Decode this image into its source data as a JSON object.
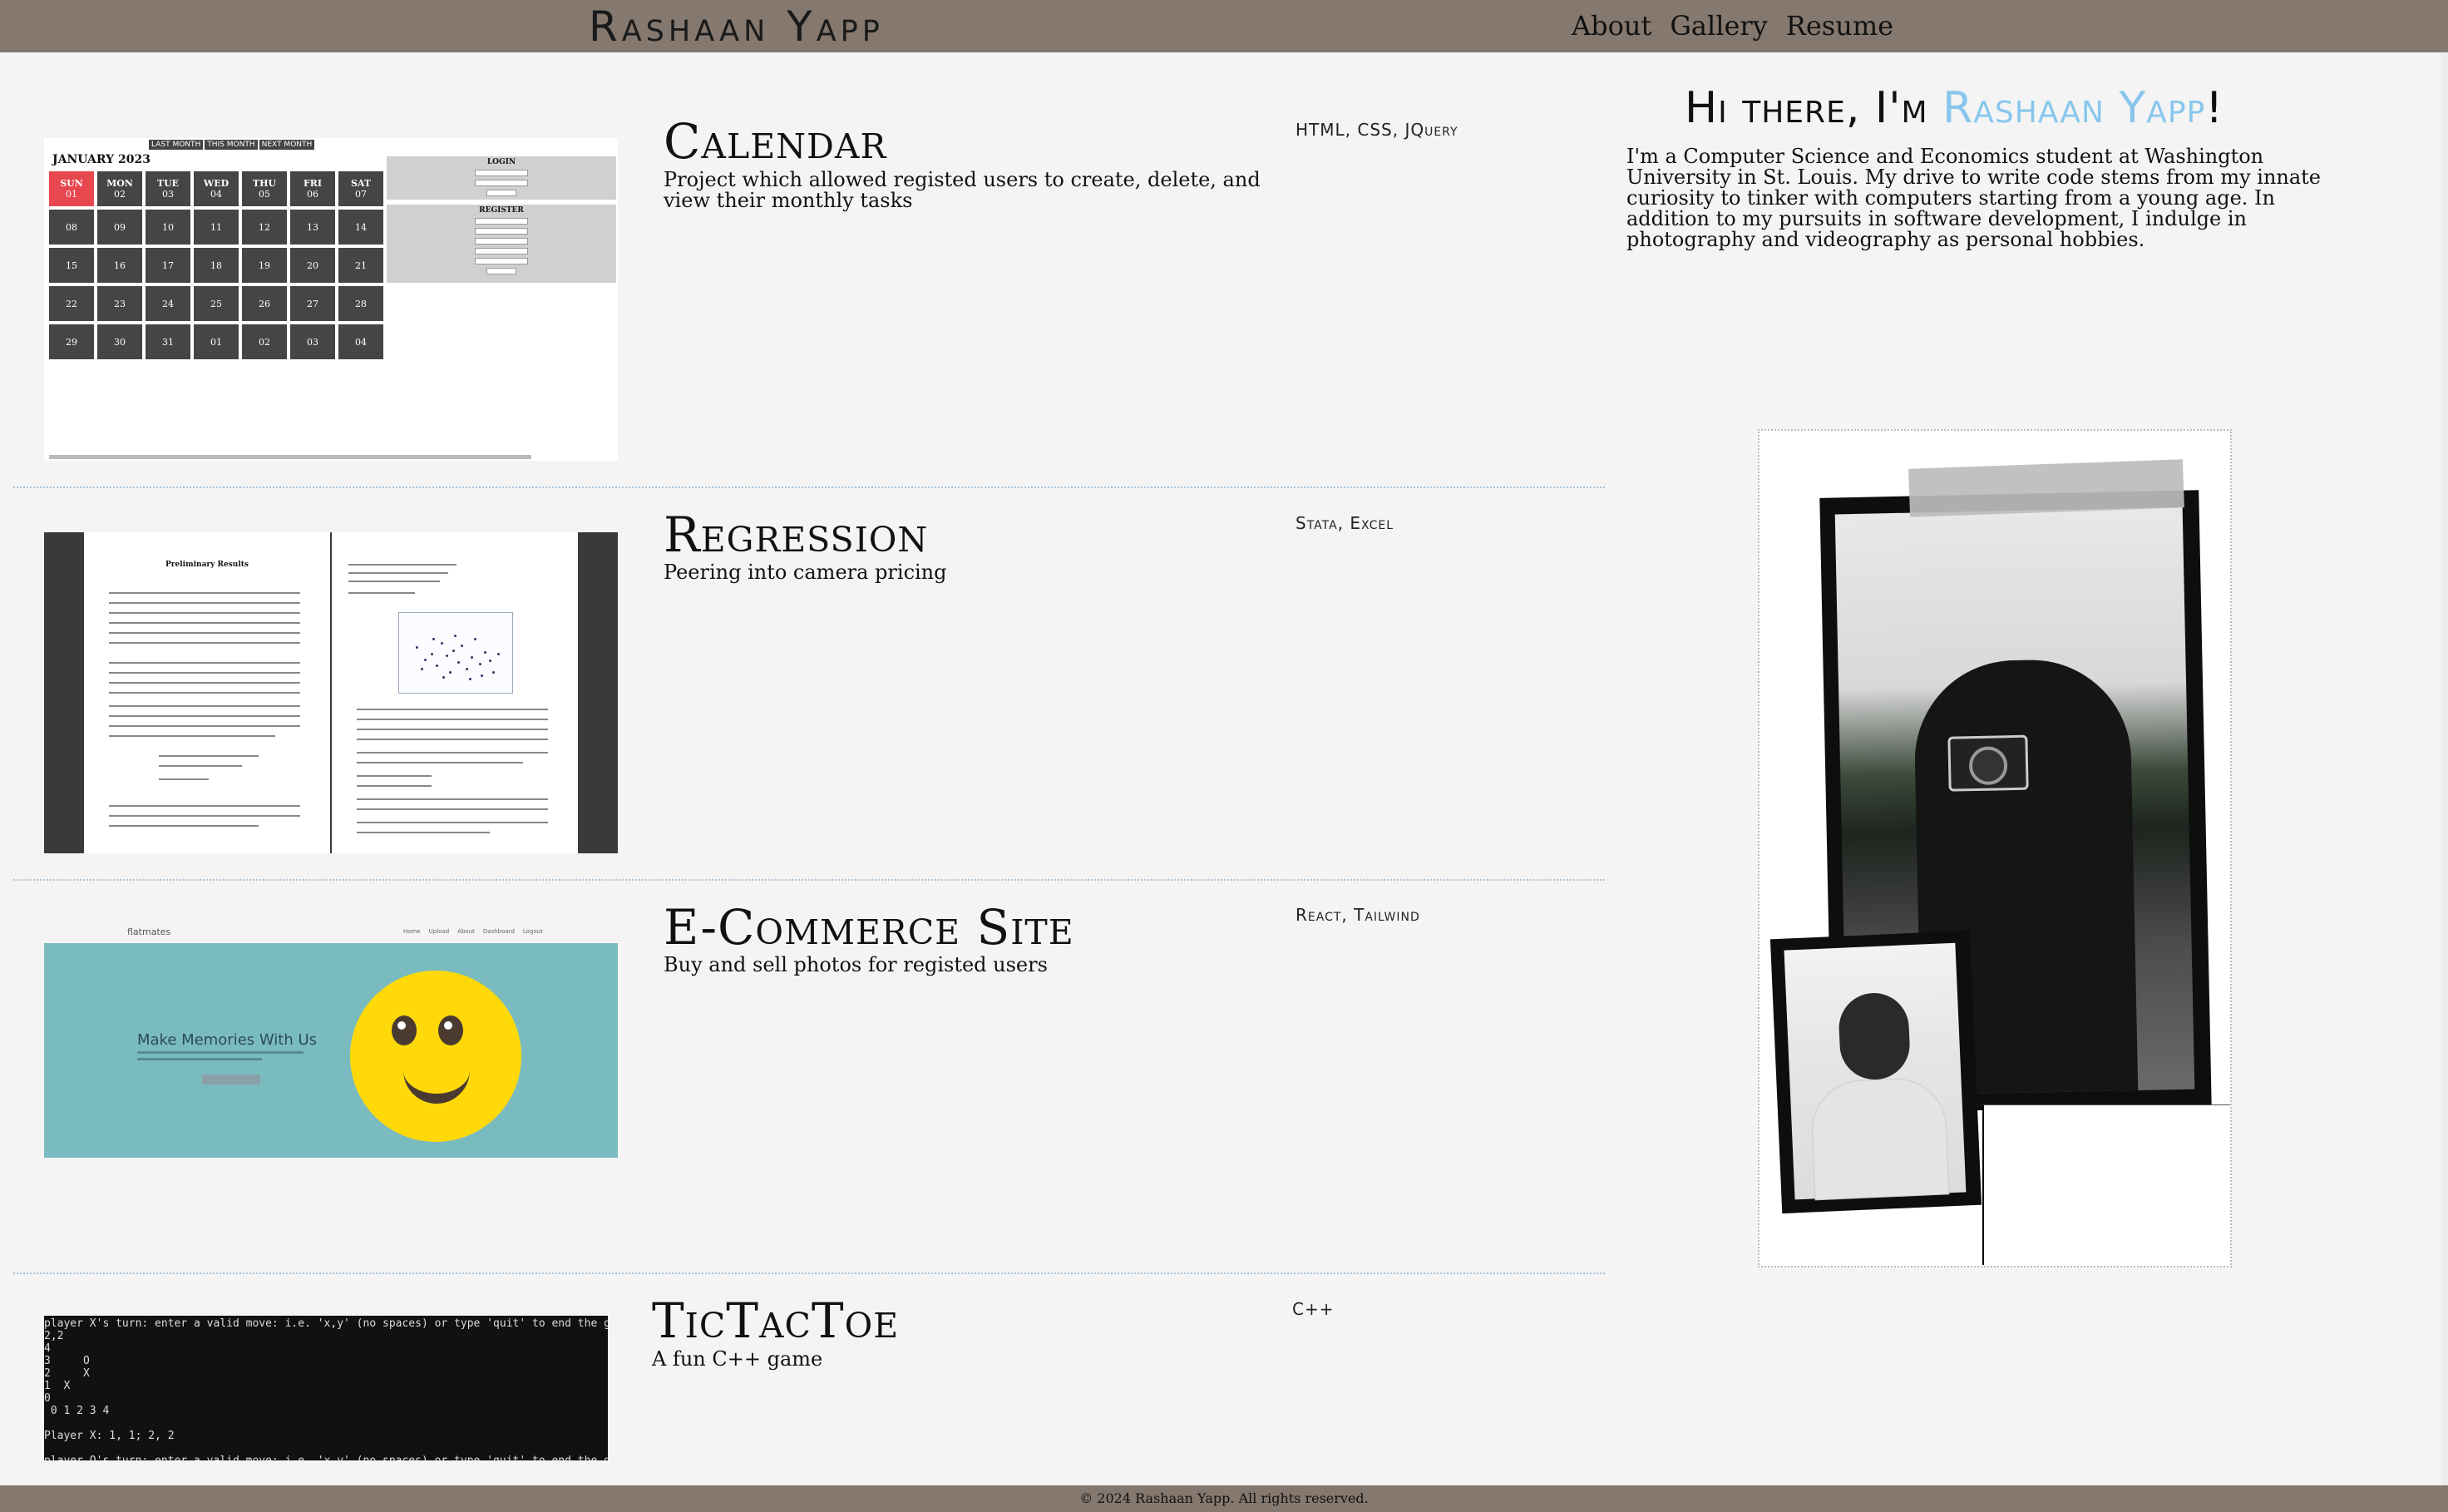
{
  "header": {
    "logo": "Rashaan Yapp",
    "nav": [
      "About",
      "Gallery",
      "Resume"
    ]
  },
  "projects": [
    {
      "title": "Calendar",
      "description": "Project which allowed registed users to create, delete, and view their monthly tasks",
      "tech": "HTML, CSS, JQuery",
      "thumb": {
        "buttons": [
          "LAST MONTH",
          "THIS MONTH",
          "NEXT MONTH"
        ],
        "month": "JANUARY 2023",
        "days": [
          {
            "d": "SUN",
            "n": "01"
          },
          {
            "d": "MON",
            "n": "02"
          },
          {
            "d": "TUE",
            "n": "03"
          },
          {
            "d": "WED",
            "n": "04"
          },
          {
            "d": "THU",
            "n": "05"
          },
          {
            "d": "FRI",
            "n": "06"
          },
          {
            "d": "SAT",
            "n": "07"
          }
        ],
        "dates": [
          "08",
          "09",
          "10",
          "11",
          "12",
          "13",
          "14",
          "15",
          "16",
          "17",
          "18",
          "19",
          "20",
          "21",
          "22",
          "23",
          "24",
          "25",
          "26",
          "27",
          "28",
          "29",
          "30",
          "31",
          "01",
          "02",
          "03",
          "04"
        ],
        "login_label": "LOGIN",
        "register_label": "REGISTER"
      }
    },
    {
      "title": "Regression",
      "description": "Peering into camera pricing",
      "tech": "Stata, Excel",
      "thumb": {
        "page_left_title": "Preliminary Results"
      }
    },
    {
      "title": "E-Commerce Site",
      "description": "Buy and sell photos for registed users",
      "tech": "React, Tailwind",
      "thumb": {
        "brand": "flatmates",
        "links": [
          "Home",
          "Upload",
          "About",
          "Dashboard",
          "Logout"
        ],
        "headline": "Make Memories With Us"
      }
    },
    {
      "title": "TicTacToe",
      "description": "A fun C++ game",
      "tech": "C++",
      "thumb": {
        "terminal": "player X's turn: enter a valid move: i.e. 'x,y' (no spaces) or type 'quit' to end the game\n2,2\n4\n3     O\n2     X\n1  X\n0\n 0 1 2 3 4\n\nPlayer X: 1, 1; 2, 2\n\nplayer O's turn: enter a valid move: i.e. 'x,y' (no spaces) or type 'quit' to end the game"
      }
    }
  ],
  "about": {
    "greeting_prefix": "Hi there, I'm ",
    "name": "Rashaan Yapp",
    "greeting_suffix": "!",
    "bio": "I'm a Computer Science and Economics student at Washington University in St. Louis. My drive to write code stems from my innate curiosity to tinker with computers starting from a young age. In addition to my pursuits in software development, I indulge in photography and videography as personal hobbies."
  },
  "footer": "© 2024 Rashaan Yapp. All rights reserved.",
  "colors": {
    "header_bg": "#85786e",
    "accent_name": "#88c6ec",
    "page_bg": "#f4f4f4",
    "calendar_today": "#e8474f",
    "ecommerce_hero": "#7abbbf"
  }
}
